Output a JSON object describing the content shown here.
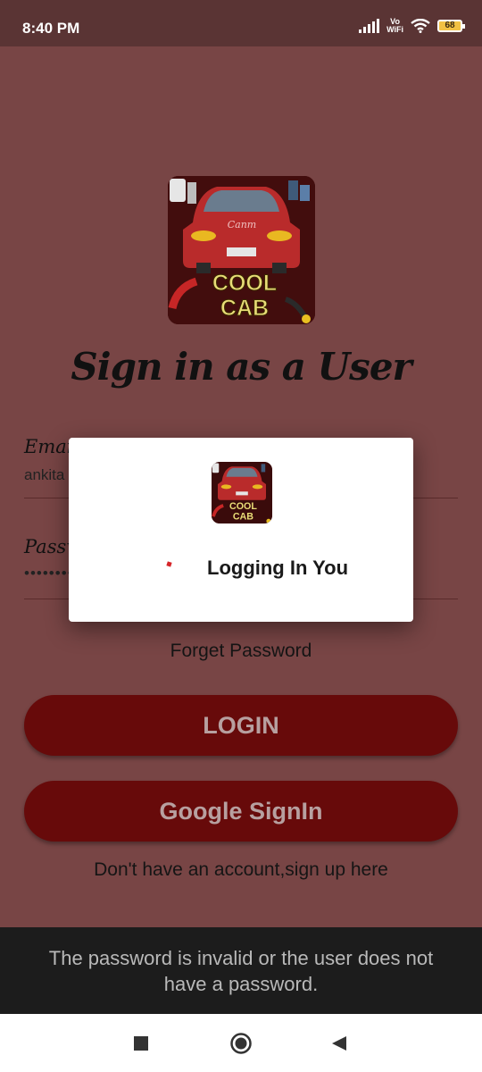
{
  "status_bar": {
    "time": "8:40 PM",
    "vowifi_top": "Vo",
    "vowifi_bottom": "WiFi",
    "battery": "68"
  },
  "logo": {
    "line1": "COOL",
    "line2": "CAB",
    "car_script": "Canm",
    "accent": "#c62626"
  },
  "page": {
    "title": "Sign in as a User"
  },
  "form": {
    "email_label": "Email",
    "email_value": "ankita",
    "password_label": "Password",
    "password_value": "••••••••"
  },
  "forget_password": "Forget Password",
  "login_button": "LOGIN",
  "google_button": "Google SignIn",
  "signup_link": "Don't have an account,sign up here",
  "dialog": {
    "message": "Logging In You"
  },
  "toast": {
    "message": "The password is invalid or the user does not have a password."
  },
  "colors": {
    "background": "#784545",
    "button": "#670a0a",
    "button_text": "#b7a0a0"
  }
}
